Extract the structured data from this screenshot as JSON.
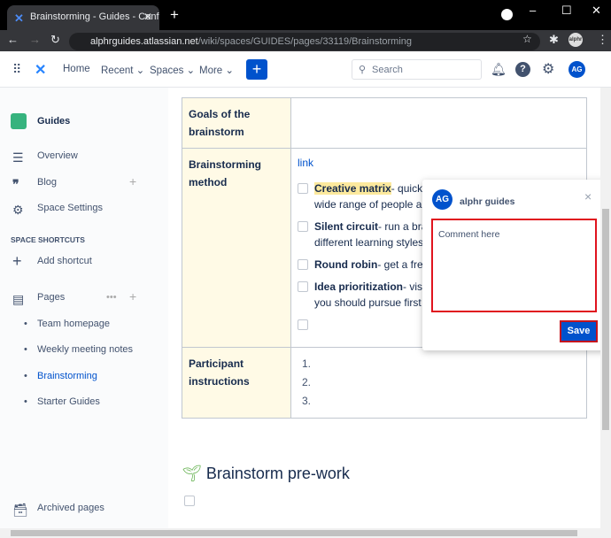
{
  "browser": {
    "tab_title": "Brainstorming - Guides - Conflue",
    "url_host": "alphrguides.atlassian.net",
    "url_path": "/wiki/spaces/GUIDES/pages/33119/Brainstorming",
    "profile": "alphr"
  },
  "nav": {
    "home": "Home",
    "recent": "Recent",
    "spaces": "Spaces",
    "more": "More",
    "create": "+",
    "search_placeholder": "Search",
    "avatar": "AG"
  },
  "sidebar": {
    "space": "Guides",
    "overview": "Overview",
    "blog": "Blog",
    "settings": "Space Settings",
    "shortcuts_header": "SPACE SHORTCUTS",
    "add_shortcut": "Add shortcut",
    "pages": "Pages",
    "children": [
      "Team homepage",
      "Weekly meeting notes",
      "Brainstorming",
      "Starter Guides"
    ],
    "archived": "Archived pages"
  },
  "table": {
    "goals": "Goals of the brainstorm",
    "method": "Brainstorming method",
    "link": "link",
    "tasks": [
      {
        "bold": "Creative matrix",
        "rest": "- quickl",
        "line2": "wide range of people ar"
      },
      {
        "bold": "Silent circuit",
        "rest": "- run a bra",
        "line2": "different learning styles"
      },
      {
        "bold": "Round robin",
        "rest": "- get a fres",
        "line2": ""
      },
      {
        "bold": "Idea prioritization",
        "rest": "- vis",
        "line2": "you should pursue first"
      }
    ],
    "participants": "Participant instructions",
    "list": [
      "1.",
      "2.",
      "3."
    ]
  },
  "heading": "Brainstorm pre-work",
  "comment": {
    "avatar": "AG",
    "user": "alphr guides",
    "placeholder": "Comment here",
    "save": "Save",
    "close": "×"
  }
}
